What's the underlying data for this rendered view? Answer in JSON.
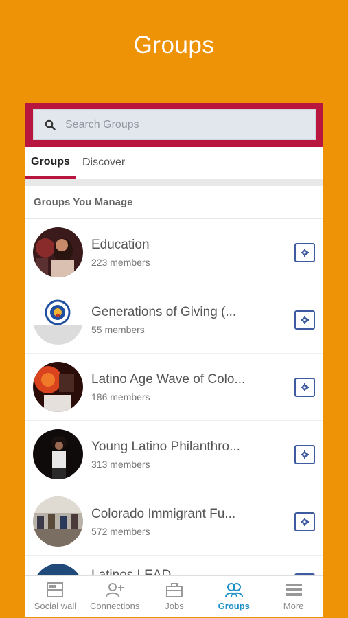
{
  "header": {
    "title": "Groups"
  },
  "search": {
    "placeholder": "Search Groups"
  },
  "tabs": [
    {
      "label": "Groups",
      "active": true
    },
    {
      "label": "Discover",
      "active": false
    }
  ],
  "section": {
    "title": "Groups You Manage"
  },
  "groups": [
    {
      "name": "Education",
      "members": "223 members"
    },
    {
      "name": "Generations of Giving (...",
      "members": "55 members"
    },
    {
      "name": "Latino Age Wave of Colo...",
      "members": "186 members"
    },
    {
      "name": "Young Latino Philanthro...",
      "members": "313 members"
    },
    {
      "name": "Colorado Immigrant Fu...",
      "members": "572 members"
    },
    {
      "name": "Latinos LEAD",
      "members": ""
    }
  ],
  "bottom_nav": [
    {
      "label": "Social wall",
      "icon": "social-wall-icon"
    },
    {
      "label": "Connections",
      "icon": "add-connection-icon"
    },
    {
      "label": "Jobs",
      "icon": "briefcase-icon"
    },
    {
      "label": "Groups",
      "icon": "groups-icon",
      "active": true
    },
    {
      "label": "More",
      "icon": "menu-icon"
    }
  ],
  "colors": {
    "background": "#EE9206",
    "accent_red": "#B8153F",
    "active_blue": "#1C8FC7",
    "settings_blue": "#3D5B9E"
  }
}
